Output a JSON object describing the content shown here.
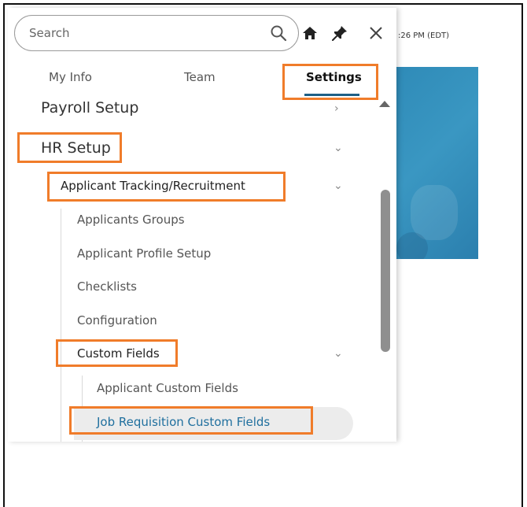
{
  "background": {
    "time_text": ":26 PM (EDT)"
  },
  "search": {
    "placeholder": "Search"
  },
  "tabs": [
    {
      "label": "My Info"
    },
    {
      "label": "Team"
    },
    {
      "label": "Settings",
      "active": true
    }
  ],
  "menu": {
    "payroll_setup": "Payroll Setup",
    "hr_setup": "HR Setup",
    "applicant_tracking": "Applicant Tracking/Recruitment",
    "applicants_groups": "Applicants Groups",
    "applicant_profile_setup": "Applicant Profile Setup",
    "checklists": "Checklists",
    "configuration": "Configuration",
    "custom_fields": "Custom Fields",
    "applicant_custom_fields": "Applicant Custom Fields",
    "job_requisition_custom_fields": "Job Requisition Custom Fields"
  },
  "icons": {
    "search": "search-icon",
    "home": "home-icon",
    "pin": "pin-icon",
    "close": "close-icon",
    "chevron_right": "chevron-right-icon",
    "chevron_down": "chevron-down-icon"
  },
  "colors": {
    "highlight": "#f07c2a",
    "active_tab_underline": "#1d5f86",
    "selected_item_text": "#1f6f9e",
    "banner": "#2f8bb8"
  }
}
